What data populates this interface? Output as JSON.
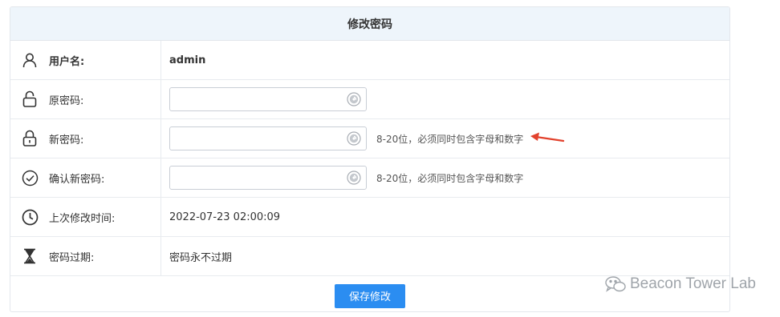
{
  "header": {
    "title": "修改密码"
  },
  "rows": {
    "username": {
      "label": "用户名:",
      "value": "admin",
      "icon": "user-icon"
    },
    "old_password": {
      "label": "原密码:",
      "value": "",
      "icon": "unlocked-icon"
    },
    "new_password": {
      "label": "新密码:",
      "value": "",
      "hint": "8-20位，必须同时包含字母和数字",
      "icon": "locked-icon"
    },
    "confirm_password": {
      "label": "确认新密码:",
      "value": "",
      "hint": "8-20位，必须同时包含字母和数字",
      "icon": "check-circle-icon"
    },
    "last_modified": {
      "label": "上次修改时间:",
      "value": "2022-07-23 02:00:09",
      "icon": "clock-icon"
    },
    "expiry": {
      "label": "密码过期:",
      "value": "密码永不过期",
      "icon": "hourglass-icon"
    }
  },
  "footer": {
    "save_label": "保存修改"
  },
  "watermark": {
    "text": "Beacon Tower Lab"
  },
  "colors": {
    "header_bg": "#eef5fb",
    "button": "#2b8df1",
    "arrow": "#e2422d",
    "border": "#e3e7ec"
  }
}
